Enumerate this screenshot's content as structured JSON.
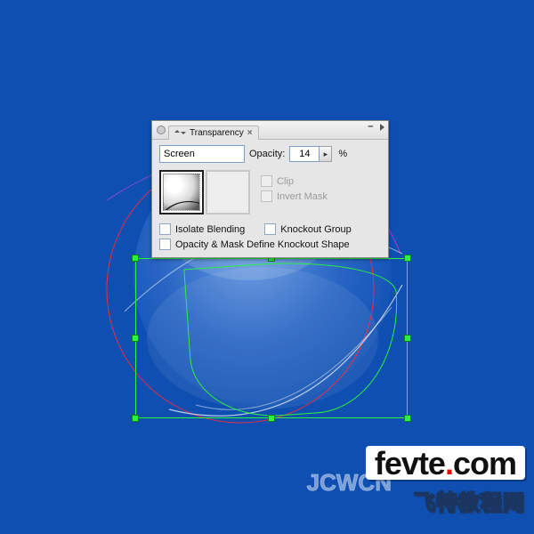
{
  "panel": {
    "tab_label": "Transparency",
    "blend_mode": {
      "value": "Screen"
    },
    "opacity": {
      "label": "Opacity:",
      "value": "14",
      "suffix": "%"
    },
    "mask": {
      "clip_label": "Clip",
      "invert_label": "Invert Mask"
    },
    "options": {
      "isolate": "Isolate Blending",
      "knockout": "Knockout Group",
      "define": "Opacity & Mask Define Knockout Shape"
    }
  },
  "watermark": {
    "brand_left": "fevte",
    "brand_dot": ".",
    "brand_right": "com",
    "ghost_text": "JCWCN",
    "subtitle": "飞特教程网"
  }
}
